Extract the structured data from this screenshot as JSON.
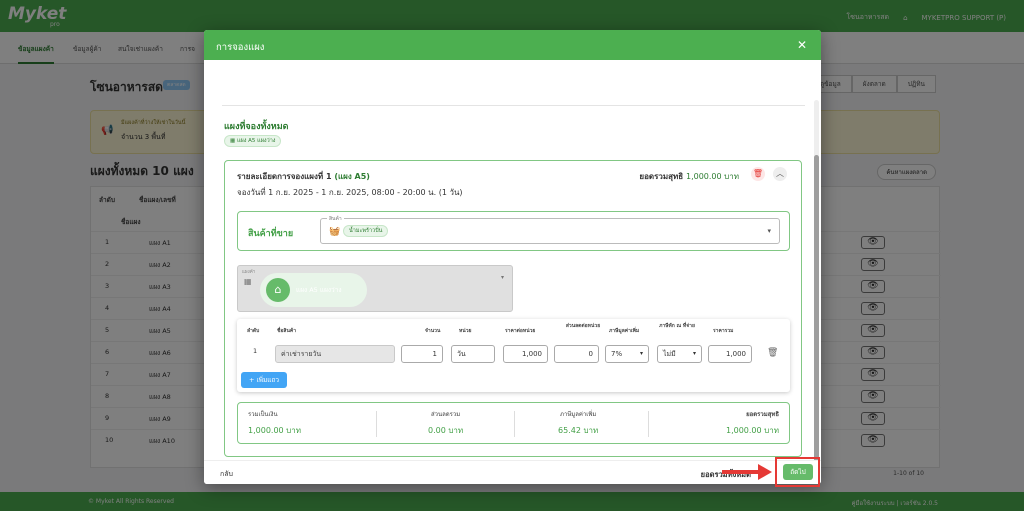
{
  "app": {
    "logo": "Myket",
    "logo_sub": "pro",
    "top_right": {
      "item1": "โซนอาหารสด",
      "user": "MYKETPRO SUPPORT (P)"
    },
    "tabs": [
      "ข้อมูลแผงค้า",
      "ข้อมูลผู้ค้า",
      "สนใจเช่าแผงค้า",
      "การจ"
    ],
    "zone_title": "โซนอาหารสด",
    "zone_badge": "ตลาดสด",
    "right_buttons": [
      "ดูข้อมูล",
      "ผังตลาด",
      "ปฏิทิน"
    ],
    "banner_line1": "มีแผงค้าที่ว่างให้เช่าในวันนี้",
    "banner_line2": "จำนวน 3 พื้นที่",
    "all_title": "แผงทั้งหมด 10 แผง",
    "all_button": "ค้นหาแผงตลาด",
    "headers": [
      "ลำดับ",
      "ชื่อแผง/เลขที่",
      "ชื่อแผง"
    ],
    "rows": [
      {
        "num": "1",
        "name": "แผง A1"
      },
      {
        "num": "2",
        "name": "แผง A2"
      },
      {
        "num": "3",
        "name": "แผง A3"
      },
      {
        "num": "4",
        "name": "แผง A4"
      },
      {
        "num": "5",
        "name": "แผง A5"
      },
      {
        "num": "6",
        "name": "แผง A6"
      },
      {
        "num": "7",
        "name": "แผง A7"
      },
      {
        "num": "8",
        "name": "แผง A8"
      },
      {
        "num": "9",
        "name": "แผง A9"
      },
      {
        "num": "10",
        "name": "แผง A10"
      }
    ],
    "pager": "1-10 of 10",
    "footer_left": "© Myket All Rights Reserved",
    "footer_right": "คู่มือใช้งานระบบ | เวอร์ชัน 2.0.5"
  },
  "modal": {
    "title": "การจองแผง",
    "section_title": "แผงที่จองทั้งหมด",
    "section_chip": "แผง A5 แผงว่าง",
    "card": {
      "title_prefix": "รายละเอียดการจองแผงที่ 1",
      "title_stall": "(แผง A5)",
      "date": "จองวันที่ 1 ก.ย. 2025 - 1 ก.ย. 2025, 08:00 - 20:00 น. (1 วัน)",
      "total_label": "ยอดรวมสุทธิ",
      "total_value": "1,000.00 บาท"
    },
    "product": {
      "label": "สินค้าที่ขาย",
      "legend": "สินค้า",
      "chip": "น้ำมะพร้าวปั่น"
    },
    "stall": {
      "legend": "แผงค้า",
      "chip": "แผง A5 แผงว่าง"
    },
    "items_table": {
      "headers": {
        "idx": "ลำดับ",
        "name": "ชื่อสินค้า",
        "qty": "จำนวน",
        "unit": "หน่วย",
        "price": "ราคาต่อหน่วย",
        "discount": "ส่วนลดต่อหน่วย",
        "vat": "ภาษีมูลค่าเพิ่ม",
        "wht": "ภาษีหัก ณ ที่จ่าย",
        "total": "ราคารวม"
      },
      "row": {
        "idx": "1",
        "name": "ค่าเช่ารายวัน",
        "qty": "1",
        "unit": "วัน",
        "price": "1,000",
        "discount": "0",
        "vat": "7%",
        "wht": "ไม่มี",
        "total": "1,000"
      },
      "add_button": "+ เพิ่มแถว"
    },
    "summary": {
      "subtotal_label": "รวมเป็นเงิน",
      "subtotal_value": "1,000.00 บาท",
      "discount_label": "ส่วนลดรวม",
      "discount_value": "0.00 บาท",
      "vat_label": "ภาษีมูลค่าเพิ่ม",
      "vat_value": "65.42 บาท",
      "net_label": "ยอดรวมสุทธิ",
      "net_value": "1,000.00 บาท"
    },
    "footer": {
      "back": "กลับ",
      "total_label": "ยอดรวมทั้งหมด",
      "next": "ถัดไป"
    }
  },
  "colors": {
    "brand": "#4caf50",
    "accent_text": "#2e7d32",
    "annotation": "#e53935",
    "add_button": "#42a5f5"
  }
}
